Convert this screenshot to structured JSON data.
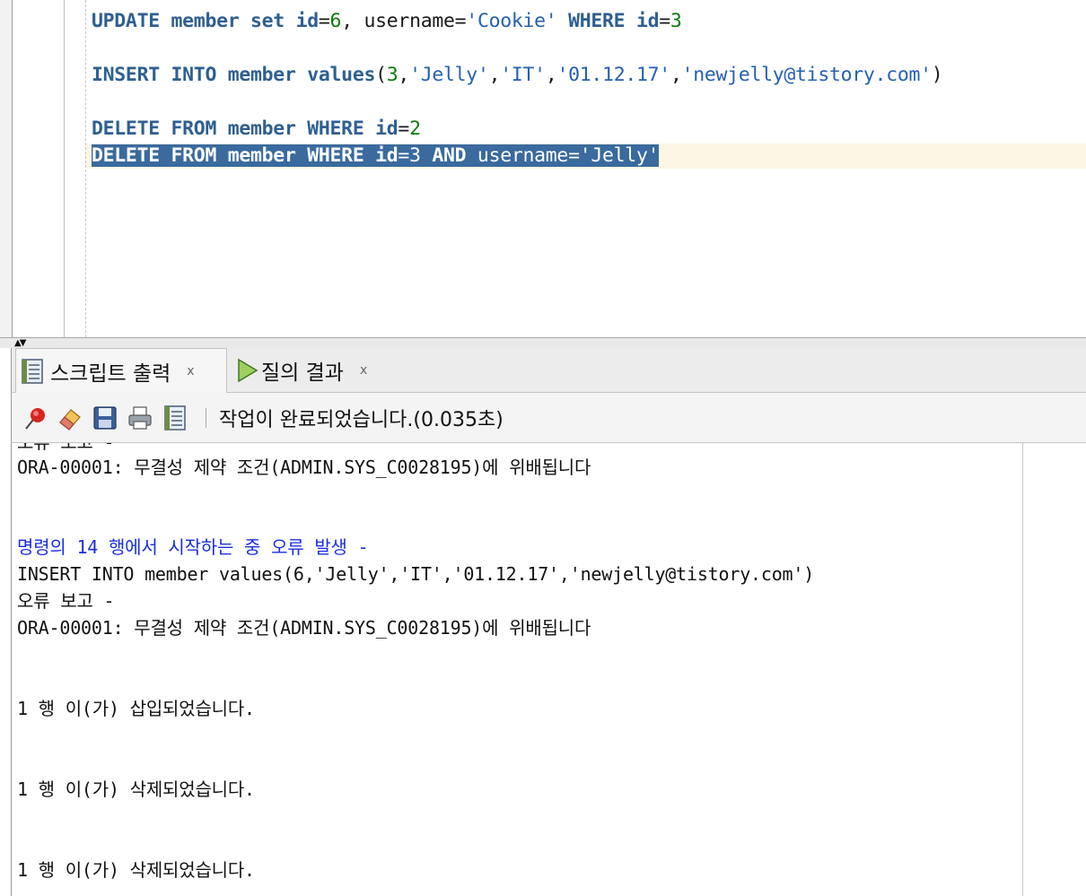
{
  "editor": {
    "lines": [
      [
        {
          "t": "UPDATE member set id",
          "c": "kw"
        },
        {
          "t": "=",
          "c": "txt"
        },
        {
          "t": "6",
          "c": "num"
        },
        {
          "t": ", username=",
          "c": "txt"
        },
        {
          "t": "'Cookie'",
          "c": "str"
        },
        {
          "t": " WHERE id",
          "c": "kw"
        },
        {
          "t": "=",
          "c": "txt"
        },
        {
          "t": "3",
          "c": "num"
        }
      ],
      [
        {
          "t": "INSERT INTO member values",
          "c": "kw"
        },
        {
          "t": "(",
          "c": "txt"
        },
        {
          "t": "3",
          "c": "num"
        },
        {
          "t": ",",
          "c": "txt"
        },
        {
          "t": "'Jelly'",
          "c": "str"
        },
        {
          "t": ",",
          "c": "txt"
        },
        {
          "t": "'IT'",
          "c": "str"
        },
        {
          "t": ",",
          "c": "txt"
        },
        {
          "t": "'01.12.17'",
          "c": "str"
        },
        {
          "t": ",",
          "c": "txt"
        },
        {
          "t": "'newjelly@tistory.com'",
          "c": "str"
        },
        {
          "t": ")",
          "c": "txt"
        }
      ],
      [
        {
          "t": "DELETE FROM member WHERE id",
          "c": "kw"
        },
        {
          "t": "=",
          "c": "txt"
        },
        {
          "t": "2",
          "c": "num"
        }
      ],
      [
        {
          "t": "DELETE FROM member WHERE id",
          "c": "kw"
        },
        {
          "t": "=3 ",
          "c": "txt"
        },
        {
          "t": "AND",
          "c": "kw"
        },
        {
          "t": " username=",
          "c": "txt"
        },
        {
          "t": "'Jelly'",
          "c": "str"
        }
      ]
    ]
  },
  "tabs": [
    {
      "label": "스크립트 출력",
      "close": "x",
      "icon": "script-output-icon"
    },
    {
      "label": "질의 결과",
      "close": "x",
      "icon": "run-query-icon"
    }
  ],
  "toolbar": {
    "buttons": [
      "pin-icon",
      "eraser-icon",
      "save-icon",
      "print-icon",
      "script-icon"
    ],
    "status": "작업이 완료되었습니다.(0.035초)"
  },
  "output": {
    "lines": [
      {
        "text": "오류 보고 -",
        "color": "normal"
      },
      {
        "text": "ORA-00001: 무결성 제약 조건(ADMIN.SYS_C0028195)에 위배됩니다",
        "color": "normal"
      },
      {
        "text": "명령의 14 행에서 시작하는 중 오류 발생 -",
        "color": "blue"
      },
      {
        "text": "INSERT INTO member values(6,'Jelly','IT','01.12.17','newjelly@tistory.com')",
        "color": "normal"
      },
      {
        "text": "오류 보고 -",
        "color": "normal"
      },
      {
        "text": "ORA-00001: 무결성 제약 조건(ADMIN.SYS_C0028195)에 위배됩니다",
        "color": "normal"
      },
      {
        "text": "1 행 이(가) 삽입되었습니다.",
        "color": "normal"
      },
      {
        "text": "1 행 이(가) 삭제되었습니다.",
        "color": "normal"
      },
      {
        "text": "1 행 이(가) 삭제되었습니다.",
        "color": "normal"
      }
    ]
  },
  "colors": {
    "keyword": "#2f5f91",
    "number": "#087d08",
    "string": "#2560b3",
    "selection": "#3a6a9e",
    "current_line": "#fdf6e4",
    "error_header": "#1b2ee0"
  }
}
